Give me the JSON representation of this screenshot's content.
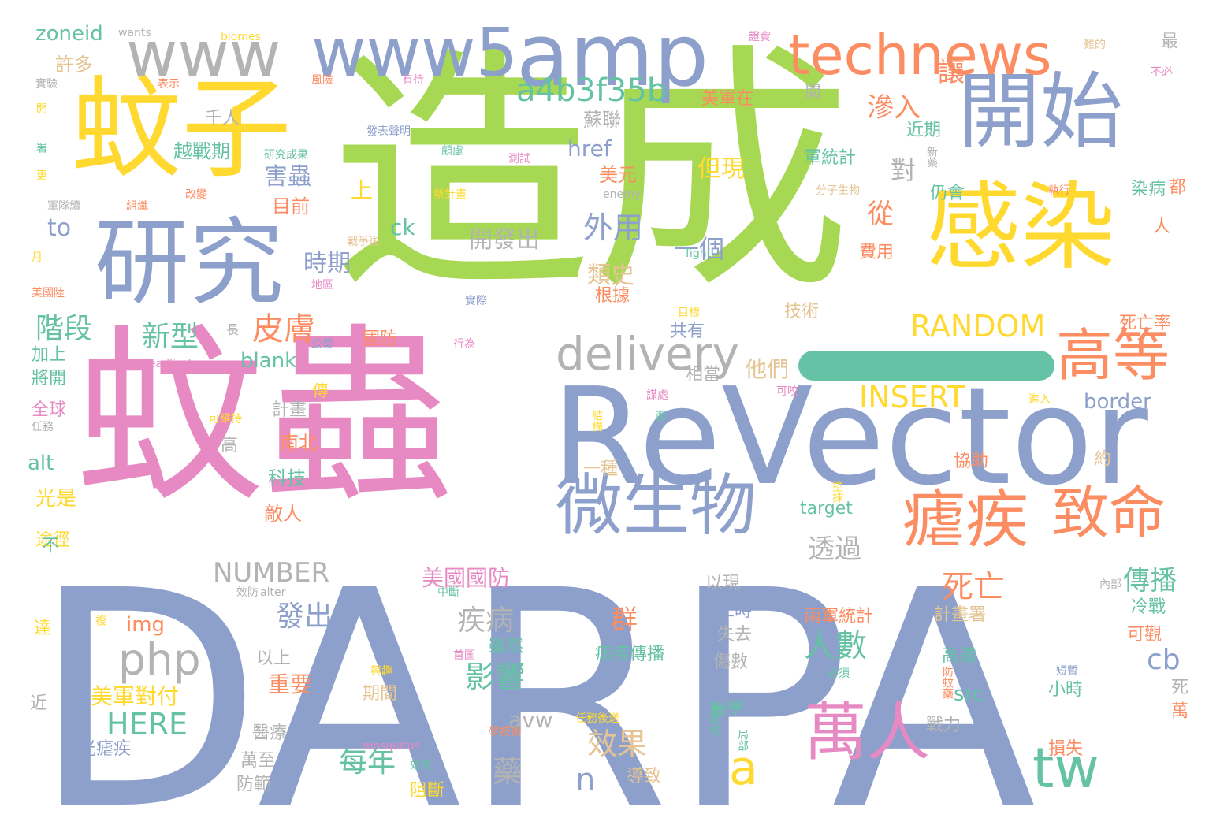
{
  "palette": {
    "blue": "#8da0cb",
    "green": "#a6d854",
    "pink": "#e78ac3",
    "yellow": "#ffd92f",
    "orange": "#fc8d62",
    "teal": "#66c2a5",
    "gray": "#b3b3b3",
    "tan": "#e5c494"
  },
  "words": [
    {
      "text": "DARPA",
      "color": "blue"
    },
    {
      "text": "造成",
      "color": "green"
    },
    {
      "text": "蚊蟲",
      "color": "pink"
    },
    {
      "text": "ReVector",
      "color": "blue"
    },
    {
      "text": "蚊子",
      "color": "yellow"
    },
    {
      "text": "研究",
      "color": "blue"
    },
    {
      "text": "開始",
      "color": "blue"
    },
    {
      "text": "感染",
      "color": "yellow"
    },
    {
      "text": "amp",
      "color": "blue"
    },
    {
      "text": "www",
      "color": "gray"
    },
    {
      "text": "www5",
      "color": "blue"
    },
    {
      "text": "technews",
      "color": "orange"
    },
    {
      "text": "微生物",
      "color": "blue"
    },
    {
      "text": "瘧疾",
      "color": "orange"
    },
    {
      "text": "致命",
      "color": "orange"
    },
    {
      "text": "萬人",
      "color": "pink"
    },
    {
      "text": "高等",
      "color": "orange"
    },
    {
      "text": "tw",
      "color": "teal"
    },
    {
      "text": "delivery",
      "color": "gray"
    },
    {
      "text": "a4b3f35b",
      "color": "teal"
    },
    {
      "text": "php",
      "color": "gray"
    },
    {
      "text": "a",
      "color": "yellow"
    },
    {
      "text": "RANDOM",
      "color": "yellow"
    },
    {
      "text": "INSERT",
      "color": "yellow"
    },
    {
      "text": "NUMBER",
      "color": "gray"
    },
    {
      "text": "HERE",
      "color": "teal"
    },
    {
      "text": "皮膚",
      "color": "orange"
    },
    {
      "text": "新型",
      "color": "teal"
    },
    {
      "text": "階段",
      "color": "teal"
    },
    {
      "text": "外用",
      "color": "blue"
    },
    {
      "text": "滲入",
      "color": "orange"
    },
    {
      "text": "讓",
      "color": "orange"
    },
    {
      "text": "從",
      "color": "orange"
    },
    {
      "text": "對",
      "color": "gray"
    },
    {
      "text": "一個",
      "color": "blue"
    },
    {
      "text": "但現",
      "color": "yellow"
    },
    {
      "text": "類史",
      "color": "tan"
    },
    {
      "text": "時期",
      "color": "blue"
    },
    {
      "text": "害蟲",
      "color": "blue"
    },
    {
      "text": "目前",
      "color": "orange"
    },
    {
      "text": "href",
      "color": "blue"
    },
    {
      "text": "to",
      "color": "blue"
    },
    {
      "text": "blank",
      "color": "teal"
    },
    {
      "text": "ck",
      "color": "teal"
    },
    {
      "text": "上",
      "color": "yellow"
    },
    {
      "text": "開發出",
      "color": "gray"
    },
    {
      "text": "人數",
      "color": "teal"
    },
    {
      "text": "死亡",
      "color": "orange"
    },
    {
      "text": "發出",
      "color": "blue"
    },
    {
      "text": "疾病",
      "color": "gray"
    },
    {
      "text": "影響",
      "color": "teal"
    },
    {
      "text": "效果",
      "color": "tan"
    },
    {
      "text": "每年",
      "color": "teal"
    },
    {
      "text": "藥",
      "color": "gray"
    },
    {
      "text": "n",
      "color": "blue"
    },
    {
      "text": "透過",
      "color": "gray"
    },
    {
      "text": "傳播",
      "color": "teal"
    },
    {
      "text": "cb",
      "color": "blue"
    },
    {
      "text": "border",
      "color": "blue"
    },
    {
      "text": "他們",
      "color": "tan"
    },
    {
      "text": "美國國防",
      "color": "pink"
    },
    {
      "text": "群",
      "color": "orange"
    },
    {
      "text": "img",
      "color": "orange"
    },
    {
      "text": "重要",
      "color": "orange"
    },
    {
      "text": "美軍對付",
      "color": "yellow"
    },
    {
      "text": "src",
      "color": "teal"
    },
    {
      "text": "avw",
      "color": "gray"
    },
    {
      "text": "zoneid",
      "color": "teal"
    },
    {
      "text": "許多",
      "color": "tan"
    },
    {
      "text": "蘇聯",
      "color": "gray"
    },
    {
      "text": "美元",
      "color": "orange"
    },
    {
      "text": "越戰期",
      "color": "teal"
    },
    {
      "text": "千人",
      "color": "gray"
    },
    {
      "text": "科技",
      "color": "teal"
    },
    {
      "text": "南北",
      "color": "orange"
    },
    {
      "text": "敵人",
      "color": "orange"
    },
    {
      "text": "光是",
      "color": "yellow"
    },
    {
      "text": "alt",
      "color": "teal"
    },
    {
      "text": "全球",
      "color": "pink"
    },
    {
      "text": "加上",
      "color": "teal"
    },
    {
      "text": "將開",
      "color": "teal"
    },
    {
      "text": "計畫",
      "color": "gray"
    },
    {
      "text": "技術",
      "color": "tan"
    },
    {
      "text": "共有",
      "color": "blue"
    },
    {
      "text": "相當",
      "color": "gray"
    },
    {
      "text": "協助",
      "color": "orange"
    },
    {
      "text": "計畫署",
      "color": "tan"
    },
    {
      "text": "冷戰",
      "color": "teal"
    },
    {
      "text": "可觀",
      "color": "orange"
    },
    {
      "text": "死亡率",
      "color": "orange"
    },
    {
      "text": "染病",
      "color": "teal"
    },
    {
      "text": "仍會",
      "color": "teal"
    },
    {
      "text": "軍統計",
      "color": "teal"
    },
    {
      "text": "近期",
      "color": "teal"
    },
    {
      "text": "美軍在",
      "color": "orange"
    },
    {
      "text": "費用",
      "color": "orange"
    },
    {
      "text": "高達",
      "color": "teal"
    },
    {
      "text": "兩軍統計",
      "color": "orange"
    },
    {
      "text": "瘧疾傳播",
      "color": "teal"
    },
    {
      "text": "工時",
      "color": "blue"
    },
    {
      "text": "失去",
      "color": "gray"
    },
    {
      "text": "醫學",
      "color": "teal"
    },
    {
      "text": "傷數",
      "color": "gray"
    },
    {
      "text": "雖然",
      "color": "teal"
    },
    {
      "text": "期間",
      "color": "tan"
    },
    {
      "text": "小時",
      "color": "teal"
    },
    {
      "text": "戰力",
      "color": "gray"
    },
    {
      "text": "損失",
      "color": "orange"
    },
    {
      "text": "導致",
      "color": "tan"
    },
    {
      "text": "阻斷",
      "color": "yellow"
    },
    {
      "text": "防範",
      "color": "gray"
    },
    {
      "text": "萬至",
      "color": "gray"
    },
    {
      "text": "醫療",
      "color": "gray"
    },
    {
      "text": "光瘧疾",
      "color": "blue"
    },
    {
      "text": "以上",
      "color": "gray"
    },
    {
      "text": "高",
      "color": "gray"
    },
    {
      "text": "途徑",
      "color": "yellow"
    },
    {
      "text": "一種",
      "color": "tan"
    },
    {
      "text": "target",
      "color": "teal"
    },
    {
      "text": "國防",
      "color": "orange"
    },
    {
      "text": "根據",
      "color": "orange"
    },
    {
      "text": "以現",
      "color": "gray"
    },
    {
      "text": "人",
      "color": "orange"
    },
    {
      "text": "都",
      "color": "orange"
    },
    {
      "text": "最",
      "color": "gray"
    },
    {
      "text": "不",
      "color": "teal"
    },
    {
      "text": "近",
      "color": "gray"
    },
    {
      "text": "達",
      "color": "yellow"
    },
    {
      "text": "萬",
      "color": "orange"
    },
    {
      "text": "死",
      "color": "gray"
    },
    {
      "text": "約",
      "color": "tan"
    },
    {
      "text": "間",
      "color": "gray"
    },
    {
      "text": "傳",
      "color": "yellow"
    },
    {
      "text": "長",
      "color": "gray"
    },
    {
      "text": "wants",
      "color": "gray"
    },
    {
      "text": "biomes",
      "color": "yellow"
    },
    {
      "text": "證實",
      "color": "pink"
    },
    {
      "text": "難的",
      "color": "tan"
    },
    {
      "text": "不必",
      "color": "pink"
    },
    {
      "text": "風險",
      "color": "orange"
    },
    {
      "text": "有待",
      "color": "pink"
    },
    {
      "text": "表示",
      "color": "orange"
    },
    {
      "text": "實驗",
      "color": "gray"
    },
    {
      "text": "開",
      "color": "yellow"
    },
    {
      "text": "署",
      "color": "teal"
    },
    {
      "text": "更",
      "color": "yellow"
    },
    {
      "text": "軍隊續",
      "color": "gray"
    },
    {
      "text": "組織",
      "color": "orange"
    },
    {
      "text": "改變",
      "color": "orange"
    },
    {
      "text": "研究成果",
      "color": "teal"
    },
    {
      "text": "發表聲明",
      "color": "blue"
    },
    {
      "text": "顧慮",
      "color": "teal"
    },
    {
      "text": "測試",
      "color": "pink"
    },
    {
      "text": "新計畫",
      "color": "yellow"
    },
    {
      "text": "enemy",
      "color": "gray"
    },
    {
      "text": "分子生物",
      "color": "tan"
    },
    {
      "text": "執行",
      "color": "orange"
    },
    {
      "text": "新藥",
      "color": "gray"
    },
    {
      "text": "月",
      "color": "yellow"
    },
    {
      "text": "美國陸",
      "color": "orange"
    },
    {
      "text": "戰爭後",
      "color": "tan"
    },
    {
      "text": "地區",
      "color": "pink"
    },
    {
      "text": "fight",
      "color": "teal"
    },
    {
      "text": "實際",
      "color": "blue"
    },
    {
      "text": "目標",
      "color": "yellow"
    },
    {
      "text": "蚊藥",
      "color": "blue"
    },
    {
      "text": "行為",
      "color": "pink"
    },
    {
      "text": "deadliest",
      "color": "pink"
    },
    {
      "text": "謀處",
      "color": "pink"
    },
    {
      "text": "可咬",
      "color": "pink"
    },
    {
      "text": "進入",
      "color": "yellow"
    },
    {
      "text": "任務",
      "color": "gray"
    },
    {
      "text": "可維持",
      "color": "yellow"
    },
    {
      "text": "結構",
      "color": "yellow"
    },
    {
      "text": "還",
      "color": "teal"
    },
    {
      "text": "塗抹",
      "color": "yellow"
    },
    {
      "text": "內部",
      "color": "gray"
    },
    {
      "text": "效防",
      "color": "gray"
    },
    {
      "text": "alter",
      "color": "gray"
    },
    {
      "text": "中斷",
      "color": "teal"
    },
    {
      "text": "複",
      "color": "yellow"
    },
    {
      "text": "首圖",
      "color": "pink"
    },
    {
      "text": "興趣",
      "color": "yellow"
    },
    {
      "text": "必須",
      "color": "teal"
    },
    {
      "text": "短暫",
      "color": "blue"
    },
    {
      "text": "防蚊藥",
      "color": "orange"
    },
    {
      "text": "任務後送",
      "color": "yellow"
    },
    {
      "text": "用動物",
      "color": "teal"
    },
    {
      "text": "學技術",
      "color": "orange"
    },
    {
      "text": "局部",
      "color": "teal"
    },
    {
      "text": "mosquitos",
      "color": "pink"
    },
    {
      "text": "效用",
      "color": "teal"
    },
    {
      "text": "skin",
      "color": "yellow"
    },
    {
      "text": "生病",
      "color": "pink"
    },
    {
      "text": "human",
      "color": "orange"
    }
  ]
}
